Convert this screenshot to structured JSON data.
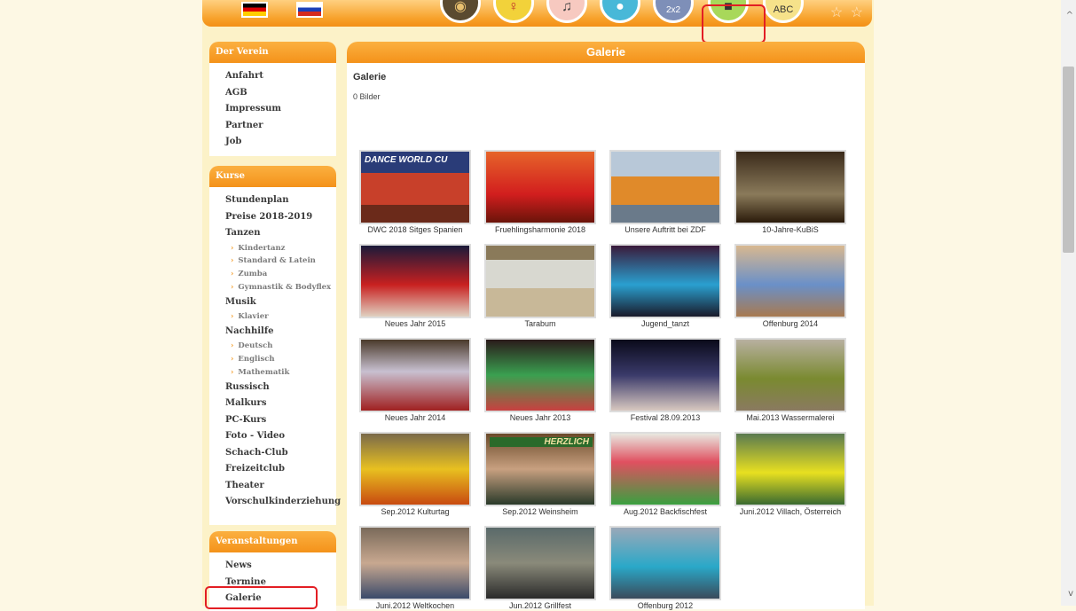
{
  "lang_flags": [
    "flag-de-icon",
    "flag-ru-icon"
  ],
  "nav_icons": [
    "drum-icon",
    "dance-icon",
    "music-icon",
    "paint-icon",
    "math-icon",
    "camera-icon",
    "abc-icon"
  ],
  "nav_math_text": "2x2",
  "nav_abc_text": "ABC",
  "sidebar": {
    "verein": {
      "title": "Der Verein",
      "items": [
        "Anfahrt",
        "AGB",
        "Impressum",
        "Partner",
        "Job"
      ]
    },
    "kurse": {
      "title": "Kurse",
      "items": [
        {
          "label": "Stundenplan",
          "sub": false
        },
        {
          "label": "Preise 2018-2019",
          "sub": false
        },
        {
          "label": "Tanzen",
          "sub": false
        },
        {
          "label": "Kindertanz",
          "sub": true
        },
        {
          "label": "Standard & Latein",
          "sub": true
        },
        {
          "label": "Zumba",
          "sub": true
        },
        {
          "label": "Gymnastik & Bodyflex",
          "sub": true
        },
        {
          "label": "Musik",
          "sub": false
        },
        {
          "label": "Klavier",
          "sub": true
        },
        {
          "label": "Nachhilfe",
          "sub": false
        },
        {
          "label": "Deutsch",
          "sub": true
        },
        {
          "label": "Englisch",
          "sub": true
        },
        {
          "label": "Mathematik",
          "sub": true
        },
        {
          "label": "Russisch",
          "sub": false
        },
        {
          "label": "Malkurs",
          "sub": false
        },
        {
          "label": "PC-Kurs",
          "sub": false
        },
        {
          "label": "Foto - Video",
          "sub": false
        },
        {
          "label": "Schach-Club",
          "sub": false
        },
        {
          "label": "Freizeitclub",
          "sub": false
        },
        {
          "label": "Theater",
          "sub": false
        },
        {
          "label": "Vorschulkinderziehung",
          "sub": false
        }
      ]
    },
    "veranstaltungen": {
      "title": "Veranstaltungen",
      "items": [
        "News",
        "Termine",
        "Galerie"
      ]
    }
  },
  "main": {
    "header": "Galerie",
    "title": "Galerie",
    "count": "0 Bilder",
    "albums": [
      {
        "caption": "DWC 2018 Sitges Spanien",
        "banner": "DANCE WORLD CU"
      },
      {
        "caption": "Fruehlingsharmonie 2018"
      },
      {
        "caption": "Unsere Auftritt bei ZDF"
      },
      {
        "caption": "10-Jahre-KuBiS"
      },
      {
        "caption": "Neues Jahr 2015"
      },
      {
        "caption": "Tarabum"
      },
      {
        "caption": "Jugend_tanzt"
      },
      {
        "caption": "Offenburg 2014"
      },
      {
        "caption": "Neues Jahr 2014"
      },
      {
        "caption": "Neues Jahr 2013"
      },
      {
        "caption": "Festival 28.09.2013"
      },
      {
        "caption": "Mai.2013 Wassermalerei"
      },
      {
        "caption": "Sep.2012 Kulturtag"
      },
      {
        "caption": "Sep.2012 Weinsheim",
        "banner": "HERZLICH"
      },
      {
        "caption": "Aug.2012 Backfischfest"
      },
      {
        "caption": "Juni.2012 Villach, Österreich"
      },
      {
        "caption": "Juni.2012 Weltkochen"
      },
      {
        "caption": "Jun.2012 Grillfest"
      },
      {
        "caption": "Offenburg 2012"
      }
    ]
  },
  "colors": {
    "accent": "#f4921a",
    "highlight": "#e31e24",
    "page_bg": "#fdf8e4"
  }
}
